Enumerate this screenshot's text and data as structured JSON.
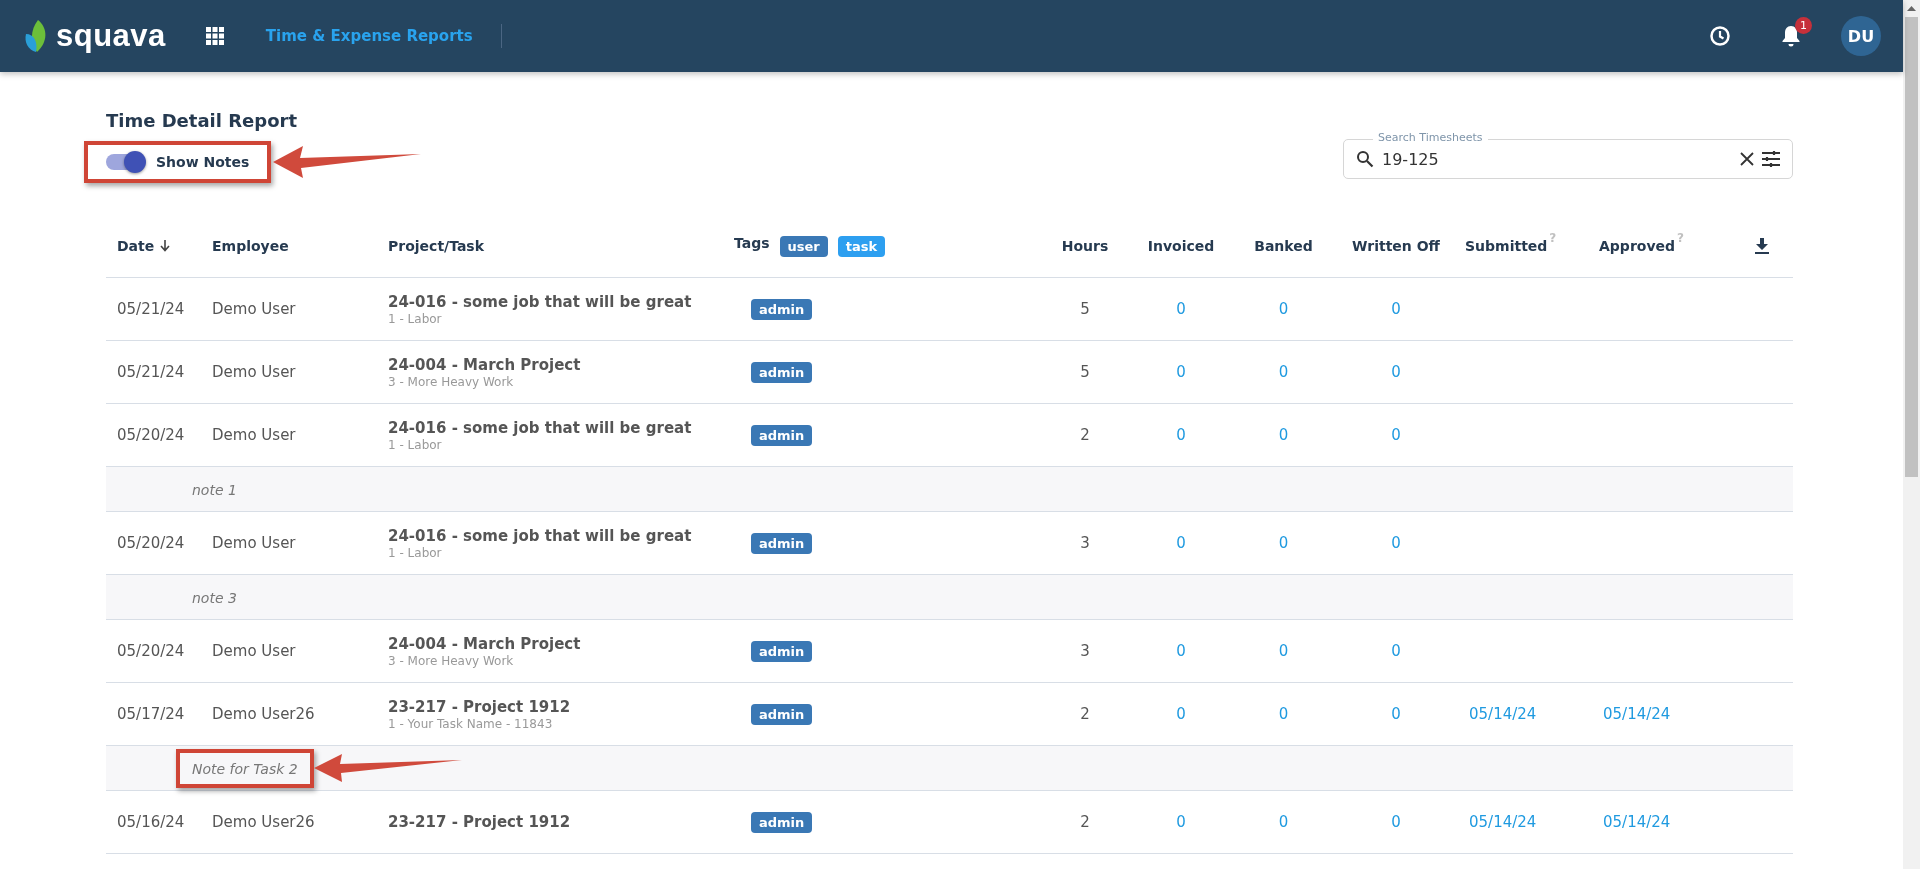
{
  "header": {
    "logo": "squava",
    "app_title": "Time & Expense Reports",
    "notifications": "1",
    "avatar": "DU"
  },
  "page_title": "Time Detail Report",
  "notes_toggle": {
    "label": "Show Notes",
    "on": true,
    "callout": true
  },
  "search": {
    "label": "Search Timesheets",
    "value": "19-125"
  },
  "columns": [
    {
      "label": "Date",
      "sorted": true
    },
    {
      "label": "Employee"
    },
    {
      "label": "Project/Task"
    },
    {
      "label": "Tags",
      "tags": [
        {
          "label": "user",
          "color": "#3a78b5"
        },
        {
          "label": "task",
          "color": "#2d9ff0"
        }
      ]
    },
    {
      "label": "Hours"
    },
    {
      "label": "Invoiced"
    },
    {
      "label": "Banked"
    },
    {
      "label": "Written Off"
    },
    {
      "label": "Submitted",
      "help": "?"
    },
    {
      "label": "Approved",
      "help": "?"
    }
  ],
  "rows": [
    {
      "kind": "entry",
      "date": "05/21/24",
      "employee": "Demo User",
      "project": "24-016 - some job that will be great",
      "task": "1 - Labor",
      "tag": "admin",
      "hours": "5",
      "invoiced": "0",
      "banked": "0",
      "written_off": "0"
    },
    {
      "kind": "entry",
      "date": "05/21/24",
      "employee": "Demo User",
      "project": "24-004 - March Project",
      "task": "3 - More Heavy Work",
      "tag": "admin",
      "hours": "5",
      "invoiced": "0",
      "banked": "0",
      "written_off": "0"
    },
    {
      "kind": "entry",
      "date": "05/20/24",
      "employee": "Demo User",
      "project": "24-016 - some job that will be great",
      "task": "1 - Labor",
      "tag": "admin",
      "hours": "2",
      "invoiced": "0",
      "banked": "0",
      "written_off": "0"
    },
    {
      "kind": "note",
      "text": "note 1",
      "callout": false
    },
    {
      "kind": "entry",
      "date": "05/20/24",
      "employee": "Demo User",
      "project": "24-016 - some job that will be great",
      "task": "1 - Labor",
      "tag": "admin",
      "hours": "3",
      "invoiced": "0",
      "banked": "0",
      "written_off": "0"
    },
    {
      "kind": "note",
      "text": "note 3",
      "callout": false
    },
    {
      "kind": "entry",
      "date": "05/20/24",
      "employee": "Demo User",
      "project": "24-004 - March Project",
      "task": "3 - More Heavy Work",
      "tag": "admin",
      "hours": "3",
      "invoiced": "0",
      "banked": "0",
      "written_off": "0"
    },
    {
      "kind": "entry",
      "date": "05/17/24",
      "employee": "Demo User26",
      "project": "23-217 - Project 1912",
      "task": "1 - Your Task Name - 11843",
      "tag": "admin",
      "hours": "2",
      "invoiced": "0",
      "banked": "0",
      "written_off": "0",
      "submitted": "05/14/24",
      "approved": "05/14/24"
    },
    {
      "kind": "note",
      "text": "Note for Task 2",
      "callout": true
    },
    {
      "kind": "entry",
      "date": "05/16/24",
      "employee": "Demo User26",
      "project": "23-217 - Project 1912",
      "tag": "admin",
      "hours": "2",
      "invoiced": "0",
      "banked": "0",
      "written_off": "0",
      "submitted": "05/14/24",
      "approved": "05/14/24"
    }
  ]
}
